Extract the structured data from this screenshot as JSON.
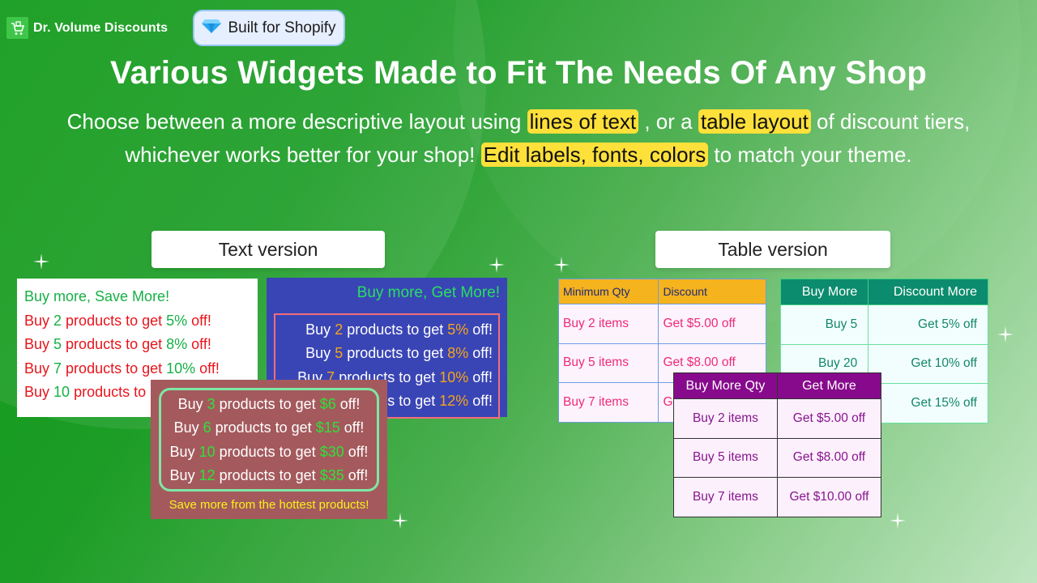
{
  "brand": {
    "name": "Dr. Volume Discounts",
    "logo_icon": "shopping-cart-icon"
  },
  "badge": {
    "icon": "diamond-icon",
    "label": "Built for Shopify"
  },
  "hero": {
    "title": "Various Widgets Made to Fit The Needs Of Any Shop",
    "subtitle": {
      "p1": "Choose between a more descriptive layout using ",
      "h1": "lines of text",
      "p2": " , or a ",
      "h2": "table layout",
      "p3": " of discount tiers, whichever works better for your shop! ",
      "h3": "Edit labels, fonts, colors",
      "p4": " to match your theme."
    }
  },
  "sections": {
    "text_label": "Text version",
    "table_label": "Table version"
  },
  "text_widget_1": {
    "heading": "Buy more, Save More!",
    "lines": [
      {
        "pre": "Buy ",
        "qty": "2",
        "mid": " products to get ",
        "disc": "5%",
        "post": " off!"
      },
      {
        "pre": "Buy ",
        "qty": "5",
        "mid": " products to get ",
        "disc": "8%",
        "post": " off!"
      },
      {
        "pre": "Buy ",
        "qty": "7",
        "mid": " products to get ",
        "disc": "10%",
        "post": " off!"
      },
      {
        "pre": "Buy ",
        "qty": "10",
        "mid": " products to ",
        "disc": "",
        "post": ""
      }
    ]
  },
  "text_widget_2": {
    "heading": "Buy more, Get More!",
    "lines": [
      {
        "pre": "Buy ",
        "qty": "2",
        "mid": " products to get ",
        "disc": "5%",
        "post": " off!"
      },
      {
        "pre": "Buy ",
        "qty": "5",
        "mid": " products to get ",
        "disc": "8%",
        "post": " off!"
      },
      {
        "pre": "Buy ",
        "qty": "7",
        "mid": " products to get ",
        "disc": "10%",
        "post": " off!"
      },
      {
        "pre": "",
        "qty": "",
        "mid": "s to get ",
        "disc": "12%",
        "post": " off!"
      }
    ]
  },
  "text_widget_3": {
    "lines": [
      {
        "pre": "Buy ",
        "qty": "3",
        "mid": " products to get ",
        "disc": "$6",
        "post": " off!"
      },
      {
        "pre": "Buy ",
        "qty": "6",
        "mid": " products to get ",
        "disc": "$15",
        "post": " off!"
      },
      {
        "pre": "Buy ",
        "qty": "10",
        "mid": " products to get ",
        "disc": "$30",
        "post": " off!"
      },
      {
        "pre": "Buy ",
        "qty": "12",
        "mid": " products to get ",
        "disc": "$35",
        "post": " off!"
      }
    ],
    "footer": "Save more from the hottest products!"
  },
  "table_widget_1": {
    "headers": [
      "Minimum Qty",
      "Discount"
    ],
    "rows": [
      [
        "Buy 2 items",
        "Get $5.00 off"
      ],
      [
        "Buy 5 items",
        "Get $8.00 off"
      ],
      [
        "Buy 7 items",
        "G"
      ]
    ]
  },
  "table_widget_2": {
    "headers": [
      "Buy More",
      "Discount More"
    ],
    "rows": [
      [
        "Buy 5",
        "Get 5% off"
      ],
      [
        "Buy 20",
        "Get 10% off"
      ],
      [
        "",
        "Get 15% off"
      ]
    ]
  },
  "table_widget_3": {
    "headers": [
      "Buy More Qty",
      "Get More"
    ],
    "rows": [
      [
        "Buy 2 items",
        "Get $5.00 off"
      ],
      [
        "Buy 5 items",
        "Get $8.00 off"
      ],
      [
        "Buy 7 items",
        "Get $10.00 off"
      ]
    ]
  },
  "colors": {
    "background_start": "#0e9a16",
    "background_end": "#bfe5c0",
    "highlight": "#fde03a",
    "widget2_bg": "#3a45b5",
    "widget3_bg": "#a45a5d",
    "table1_header": "#f5b31d",
    "table2_header": "#0c8c6e",
    "table3_header": "#870a8c"
  }
}
